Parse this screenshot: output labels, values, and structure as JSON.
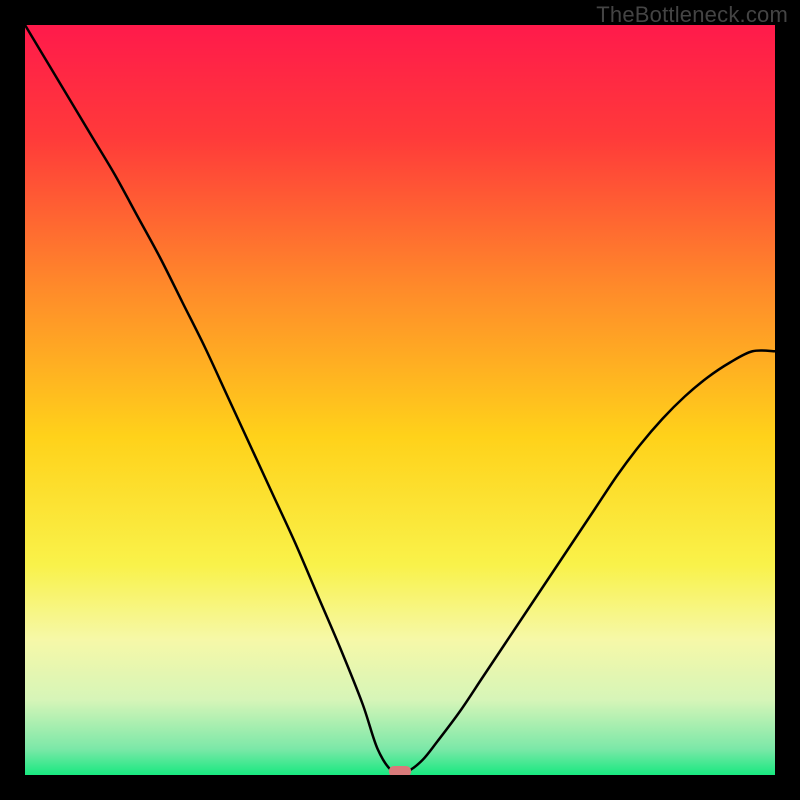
{
  "watermark": "TheBottleneck.com",
  "chart_data": {
    "type": "line",
    "title": "",
    "xlabel": "",
    "ylabel": "",
    "xlim": [
      0,
      100
    ],
    "ylim": [
      0,
      100
    ],
    "grid": false,
    "legend": false,
    "background_gradient_stops": [
      {
        "offset": 0.0,
        "color": "#ff1a4b"
      },
      {
        "offset": 0.15,
        "color": "#ff3a3a"
      },
      {
        "offset": 0.35,
        "color": "#ff8a2a"
      },
      {
        "offset": 0.55,
        "color": "#ffd21a"
      },
      {
        "offset": 0.72,
        "color": "#f9f24a"
      },
      {
        "offset": 0.82,
        "color": "#f6f8a8"
      },
      {
        "offset": 0.9,
        "color": "#d6f5b8"
      },
      {
        "offset": 0.965,
        "color": "#7ce8a8"
      },
      {
        "offset": 1.0,
        "color": "#18e880"
      }
    ],
    "series": [
      {
        "name": "bottleneck-curve",
        "color": "#000000",
        "x": [
          0.0,
          3.0,
          6.0,
          9.0,
          12.0,
          15.0,
          18.0,
          21.0,
          24.0,
          27.0,
          30.0,
          33.0,
          36.0,
          39.0,
          42.0,
          45.0,
          47.0,
          49.0,
          51.0,
          53.0,
          55.0,
          58.0,
          61.0,
          64.0,
          67.0,
          70.0,
          73.0,
          76.0,
          79.0,
          82.0,
          85.0,
          88.0,
          91.0,
          94.0,
          97.0,
          100.0
        ],
        "y": [
          100.0,
          95.0,
          90.0,
          85.0,
          80.0,
          74.5,
          69.0,
          63.0,
          57.0,
          50.5,
          44.0,
          37.5,
          31.0,
          24.0,
          17.0,
          9.5,
          3.5,
          0.5,
          0.5,
          2.0,
          4.5,
          8.5,
          13.0,
          17.5,
          22.0,
          26.5,
          31.0,
          35.5,
          40.0,
          44.0,
          47.5,
          50.5,
          53.0,
          55.0,
          56.5,
          56.5
        ]
      }
    ],
    "marker": {
      "name": "optimal-point",
      "x": 50.0,
      "y": 0.5,
      "color": "#d97a7a",
      "width": 3.0,
      "height": 1.4
    }
  }
}
